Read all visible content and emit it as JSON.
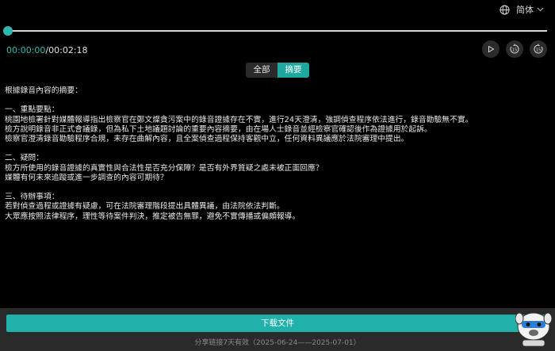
{
  "language": {
    "label": "简体"
  },
  "player": {
    "current_time": "00:00:00",
    "separator": "/",
    "total_time": "00:02:18",
    "progress": 0
  },
  "tabs": [
    {
      "label": "全部",
      "active": false
    },
    {
      "label": "摘要",
      "active": true
    }
  ],
  "summary": {
    "intro": "根據錄音內容的摘要：",
    "sections": [
      {
        "heading": "一、重點要點：",
        "lines": [
          "桃園地檢署針對媒體報導指出檢察官在鄭文燦貪污案中的錄音證據存在不實，進行24天澄清，強調偵查程序依法進行，錄音勘驗無不實。",
          "檢方說明錄音非正式會議錄，但為私下土地議題討論的重要內容摘要，由在場人士錄音並經檢察官確認後作為證據用於起訴。",
          "檢察官澄清錄音勘驗程序合規，未存在曲解內容，且全案偵查過程保持客觀中立，任何資料異議應於法院審理中提出。"
        ]
      },
      {
        "heading": "二、疑問：",
        "lines": [
          "檢方所使用的錄音證據的真實性與合法性是否充分保障？是否有外界質疑之處未被正面回應？",
          "媒體有何未來追蹤或進一步調查的內容可期待？"
        ]
      },
      {
        "heading": "三、待辦事項：",
        "lines": [
          "若對偵查過程或證據有疑慮，可在法院審理階段提出具體異議，由法院依法判斷。",
          "大眾應按照法律程序，理性等待案件判決，推定被告無罪，避免不實傳播或偏頗報導。"
        ]
      }
    ]
  },
  "footer": {
    "download_label": "下载文件",
    "share_note": "分享链接7天有效（2025-06-24——2025-07-01）"
  },
  "colors": {
    "accent": "#20b2aa",
    "background": "#000000",
    "footer": "#2a2a2a"
  }
}
